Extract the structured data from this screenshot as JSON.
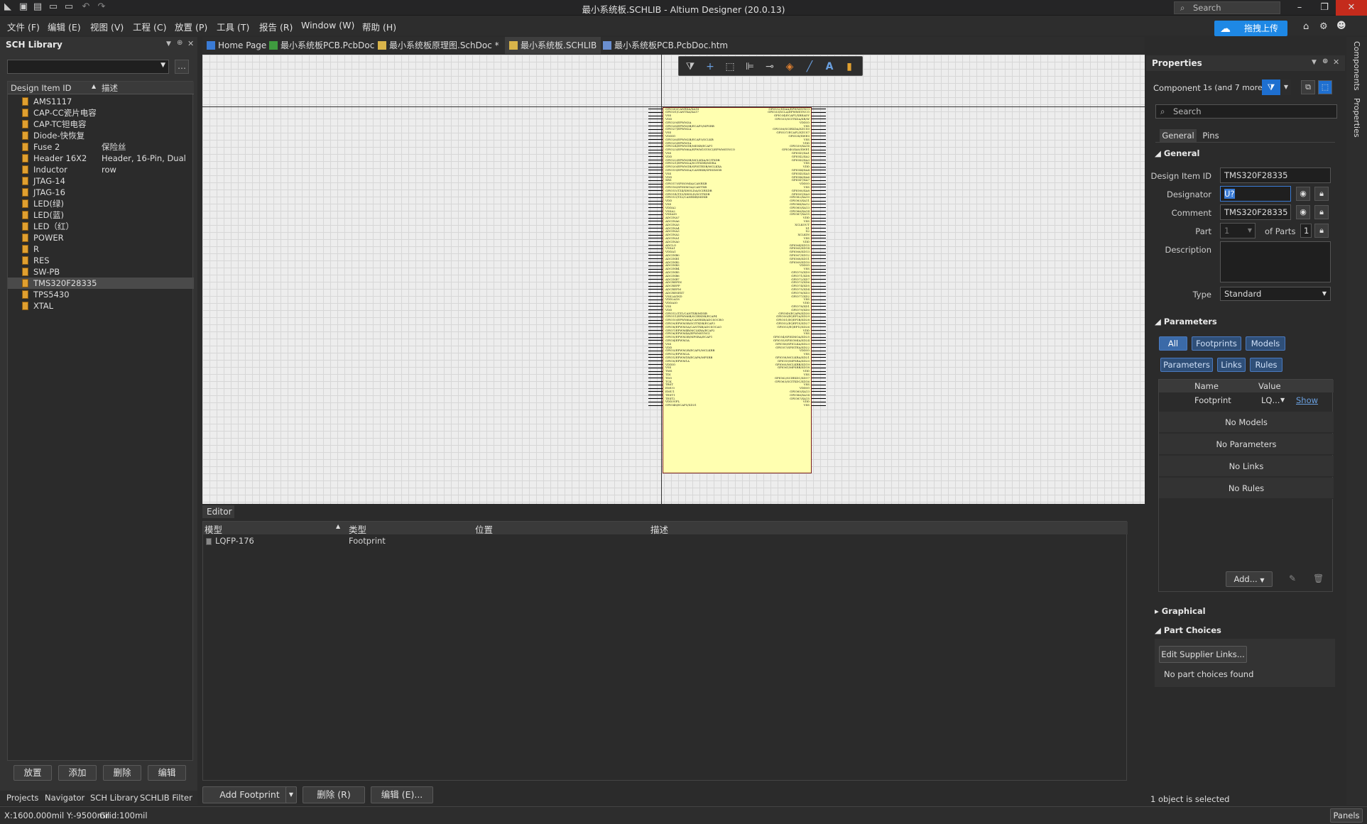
{
  "window": {
    "title": "最小系统板.SCHLIB - Altium Designer (20.0.13)",
    "search_placeholder": "Search",
    "minimize": "–",
    "restore": "❐",
    "close": "✕"
  },
  "menu": [
    "文件 (F)",
    "编辑 (E)",
    "视图 (V)",
    "工程 (C)",
    "放置 (P)",
    "工具 (T)",
    "报告 (R)",
    "Window (W)",
    "帮助 (H)"
  ],
  "upload_button": "拖拽上传",
  "left_panel": {
    "title": "SCH Library",
    "columns": [
      "Design Item ID",
      "描述"
    ],
    "items": [
      {
        "id": "AMS1117",
        "desc": ""
      },
      {
        "id": "CAP-CC瓷片电容",
        "desc": ""
      },
      {
        "id": "CAP-TC钽电容",
        "desc": ""
      },
      {
        "id": "Diode-快恢复",
        "desc": ""
      },
      {
        "id": "Fuse 2",
        "desc": "保险丝"
      },
      {
        "id": "Header 16X2",
        "desc": "Header, 16-Pin, Dual row"
      },
      {
        "id": "Inductor",
        "desc": ""
      },
      {
        "id": "JTAG-14",
        "desc": ""
      },
      {
        "id": "JTAG-16",
        "desc": ""
      },
      {
        "id": "LED(绿)",
        "desc": ""
      },
      {
        "id": "LED(蓝)",
        "desc": ""
      },
      {
        "id": "LED（红）",
        "desc": ""
      },
      {
        "id": "POWER",
        "desc": ""
      },
      {
        "id": "R",
        "desc": ""
      },
      {
        "id": "RES",
        "desc": ""
      },
      {
        "id": "SW-PB",
        "desc": ""
      },
      {
        "id": "TMS320F28335",
        "desc": "",
        "selected": true
      },
      {
        "id": "TPS5430",
        "desc": ""
      },
      {
        "id": "XTAL",
        "desc": ""
      }
    ],
    "buttons": [
      "放置",
      "添加",
      "删除",
      "编辑"
    ],
    "tabs": [
      "Projects",
      "Navigator",
      "SCH Library",
      "SCHLIB Filter"
    ]
  },
  "doc_tabs": [
    {
      "label": "Home Page",
      "icon": "home-icon"
    },
    {
      "label": "最小系统板PCB.PcbDoc",
      "icon": "pcb-doc-icon"
    },
    {
      "label": "最小系统板原理图.SchDoc *",
      "icon": "schematic-doc-icon"
    },
    {
      "label": "最小系统板.SCHLIB",
      "icon": "schlib-doc-icon",
      "active": true
    },
    {
      "label": "最小系统板PCB.PcbDoc.htm",
      "icon": "html-doc-icon"
    }
  ],
  "canvas": {
    "toolbar_icons": [
      "filter-icon",
      "cross-icon",
      "select-rect-icon",
      "align-icon",
      "place-pin-icon",
      "erase-icon",
      "line-icon",
      "text-icon",
      "part-icon"
    ],
    "pins_left": [
      "GPIO30/CANRXA/XA18",
      "GPIO31/CANTXA/XA17",
      "VSS",
      "VDD",
      "GPIO29/EPWM3A",
      "GPIO28/EPWM3B/ECAP5/MFSRB",
      "GPIO27/EPWM2A",
      "VSS",
      "VDDIO",
      "GPIO26/EPWM2B/ECAP3/SCLKB",
      "GPIO25/EPWM1A",
      "GPIO24/EPWM1B/MDXB/ECAP1",
      "GPIO23/EPWM6A/EPWM1SYNCI/EPWMSYNCO",
      "VSS",
      "VDD",
      "GPIO22/EPWM3B/MCLKXA/SCITXDB",
      "GPIO21/EPWM2A/SCITXDB/MDRA",
      "GPIO20/EPWM1B/SPISTEDB/MCLKXA",
      "GPIO19/EPWM5A/CANRXB/SPISIMOB",
      "VSS",
      "VDD",
      "XRS",
      "GPIO17/SPISOMIA/CANRXB",
      "GPIO16/SPISIMOA/CANTXB",
      "GPIO15/TZ4/XHOLDA/SCIRXDB",
      "GPIO14/TZ3/XHOLD/SCITXDB",
      "GPIO13/TZ2/CANRXB/MDXB",
      "VDD",
      "VSS",
      "VDDA2",
      "VSSA2",
      "VSSAIO",
      "ADCINA7",
      "ADCINA6",
      "ADCINA5",
      "ADCINA4",
      "ADCINA3",
      "ADCINA2",
      "ADCINA1",
      "ADCINA0",
      "ADCLO",
      "VSSA1",
      "VDDA1",
      "ADCINB0",
      "ADCINB1",
      "ADCINB2",
      "ADCINB3",
      "ADCINB4",
      "ADCINB5",
      "ADCINB6",
      "ADCINB7",
      "ADCREFIN",
      "ADCREFP",
      "ADCREFM",
      "ADCRESEXT",
      "VSS2AGND",
      "VDD2A18",
      "VDDAIO",
      "VSS",
      "VDD",
      "GPIO12/TZ1/CANTXB/MDXB",
      "GPIO11/EPWM6B/SCIRXDB/ECAP4",
      "GPIO10/EPWM6A/CANRXB/ADCSOCBO",
      "GPIO9/EPWM5B/SCITXDB/ECAP3",
      "GPIO8/EPWM5A/CANTXB/ADCSOCAO",
      "GPIO7/EPWM4B/MCLKRA/ECAP2",
      "GPIO6/EPWM4A/EPWMSYNCI",
      "GPIO5/EPWM3B/MFSRA/ECAP1",
      "GPIO4/EPWM3A",
      "VSS",
      "VDD",
      "GPIO3/EPWM2B/ECAP5/MCLKRB",
      "GPIO2/EPWM2A",
      "GPIO1/EPWM1B/ECAP6/MFSRB",
      "GPIO0/EPWM1A",
      "VDDIO",
      "VSS",
      "TMS",
      "TDI",
      "TDO",
      "TCK",
      "TRST",
      "EMU0",
      "EMU1",
      "TEST1",
      "TEST2",
      "VDD3VFL",
      "GPIO48/ECAP5/XD31"
    ],
    "pins_right": [
      "GPIO32/SDAA/EPWMSYNCI",
      "GPIO33/SCLA/EPWMSYNCO",
      "GPIO34/ECAP1/XREADY",
      "GPIO35/SCITXDA/XR/W",
      "VDDIO",
      "VSS",
      "GPIO36/SCIRXDA/XZCS0",
      "GPIO37/ECAP2/XZCS7",
      "GPIO38/XWE0",
      "VSS",
      "VDD",
      "GPIO39/XA16",
      "GPIO40/XA0/XWE1",
      "GPIO41/XA1",
      "GPIO42/XA2",
      "GPIO43/XA3",
      "VSS",
      "VDD",
      "GPIO44/XA4",
      "GPIO45/XA5",
      "GPIO46/XA6",
      "GPIO47/XA7",
      "VDDIO",
      "VSS",
      "GPIO80/XA8",
      "GPIO81/XA9",
      "GPIO82/XA10",
      "GPIO83/XA11",
      "GPIO84/XA12",
      "GPIO85/XA13",
      "GPIO86/XA14",
      "GPIO87/XA15",
      "VDD",
      "VSS",
      "XCLKOUT",
      "X1",
      "X2",
      "XCLKIN",
      "VSS",
      "VDD",
      "GPIO64/XD15",
      "GPIO65/XD14",
      "GPIO66/XD13",
      "GPIO67/XD12",
      "GPIO68/XD11",
      "GPIO69/XD10",
      "VDDIO",
      "VSS",
      "GPIO70/XD9",
      "GPIO71/XD8",
      "GPIO72/XD7",
      "GPIO73/XD6",
      "GPIO74/XD5",
      "GPIO75/XD4",
      "GPIO76/XD3",
      "GPIO77/XD2",
      "VSS",
      "VDD",
      "GPIO78/XD1",
      "GPIO79/XD0",
      "GPIO49/ECAP6/XD30",
      "GPIO50/EQEP1A/XD29",
      "GPIO51/EQEP1B/XD28",
      "GPIO52/EQEP1S/XD27",
      "GPIO53/EQEP1I/XD26",
      "VDD",
      "VSS",
      "GPIO54/SPISIMOA/XD25",
      "GPIO55/SPISOMIA/XD24",
      "GPIO56/SPICLKA/XD23",
      "GPIO57/SPISTEA/XD22",
      "VDDIO",
      "VSS",
      "GPIO58/MCLKRA/XD21",
      "GPIO59/MFSRA/XD20",
      "GPIO60/MCLKRB/XD19",
      "GPIO61/MFSRB/XD18",
      "VDD",
      "VSS",
      "GPIO62/SCIRXDC/XD17",
      "GPIO63/SCITXDC/XD16",
      "VSS",
      "VDDIO",
      "GPIO85/XA13",
      "GPIO86/XA14",
      "GPIO87/XA15",
      "VDD",
      "VSS"
    ]
  },
  "editor": {
    "tab": "Editor",
    "columns": [
      "模型",
      "类型",
      "位置",
      "描述"
    ],
    "rows": [
      {
        "model": "LQFP-176",
        "type": "Footprint",
        "location": "",
        "desc": ""
      }
    ],
    "buttons": {
      "add": "Add Footprint",
      "delete": "删除 (R)",
      "edit": "编辑 (E)..."
    }
  },
  "properties": {
    "title": "Properties",
    "component_label": "Component",
    "component_value": "1s (and 7 more)",
    "search_placeholder": "Search",
    "tabs": [
      "General",
      "Pins"
    ],
    "general_header": "General",
    "design_item_id_label": "Design Item ID",
    "design_item_id": "TMS320F28335",
    "designator_label": "Designator",
    "designator": "U?",
    "comment_label": "Comment",
    "comment": "TMS320F28335",
    "part_label": "Part",
    "part_value": "1",
    "of_parts_label": "of Parts",
    "of_parts_value": "1",
    "description_label": "Description",
    "type_label": "Type",
    "type_value": "Standard",
    "parameters_header": "Parameters",
    "param_chips_row1": [
      "All",
      "Footprints",
      "Models"
    ],
    "param_chips_row2": [
      "Parameters",
      "Links",
      "Rules"
    ],
    "param_columns": [
      "Name",
      "Value"
    ],
    "param_rows": [
      {
        "name": "Footprint",
        "value": "LQ...",
        "action": "Show"
      }
    ],
    "messages": [
      "No Models",
      "No Parameters",
      "No Links",
      "No Rules"
    ],
    "add_button": "Add...",
    "graphical_header": "Graphical",
    "part_choices_header": "Part Choices",
    "edit_supplier_button": "Edit Supplier Links...",
    "no_part_choices": "No part choices found",
    "selection_status": "1 object is selected"
  },
  "right_strip": [
    "Components",
    "Properties"
  ],
  "status": {
    "coords": "X:1600.000mil Y:-9500mil",
    "grid": "Grid:100mil",
    "panels": "Panels"
  }
}
